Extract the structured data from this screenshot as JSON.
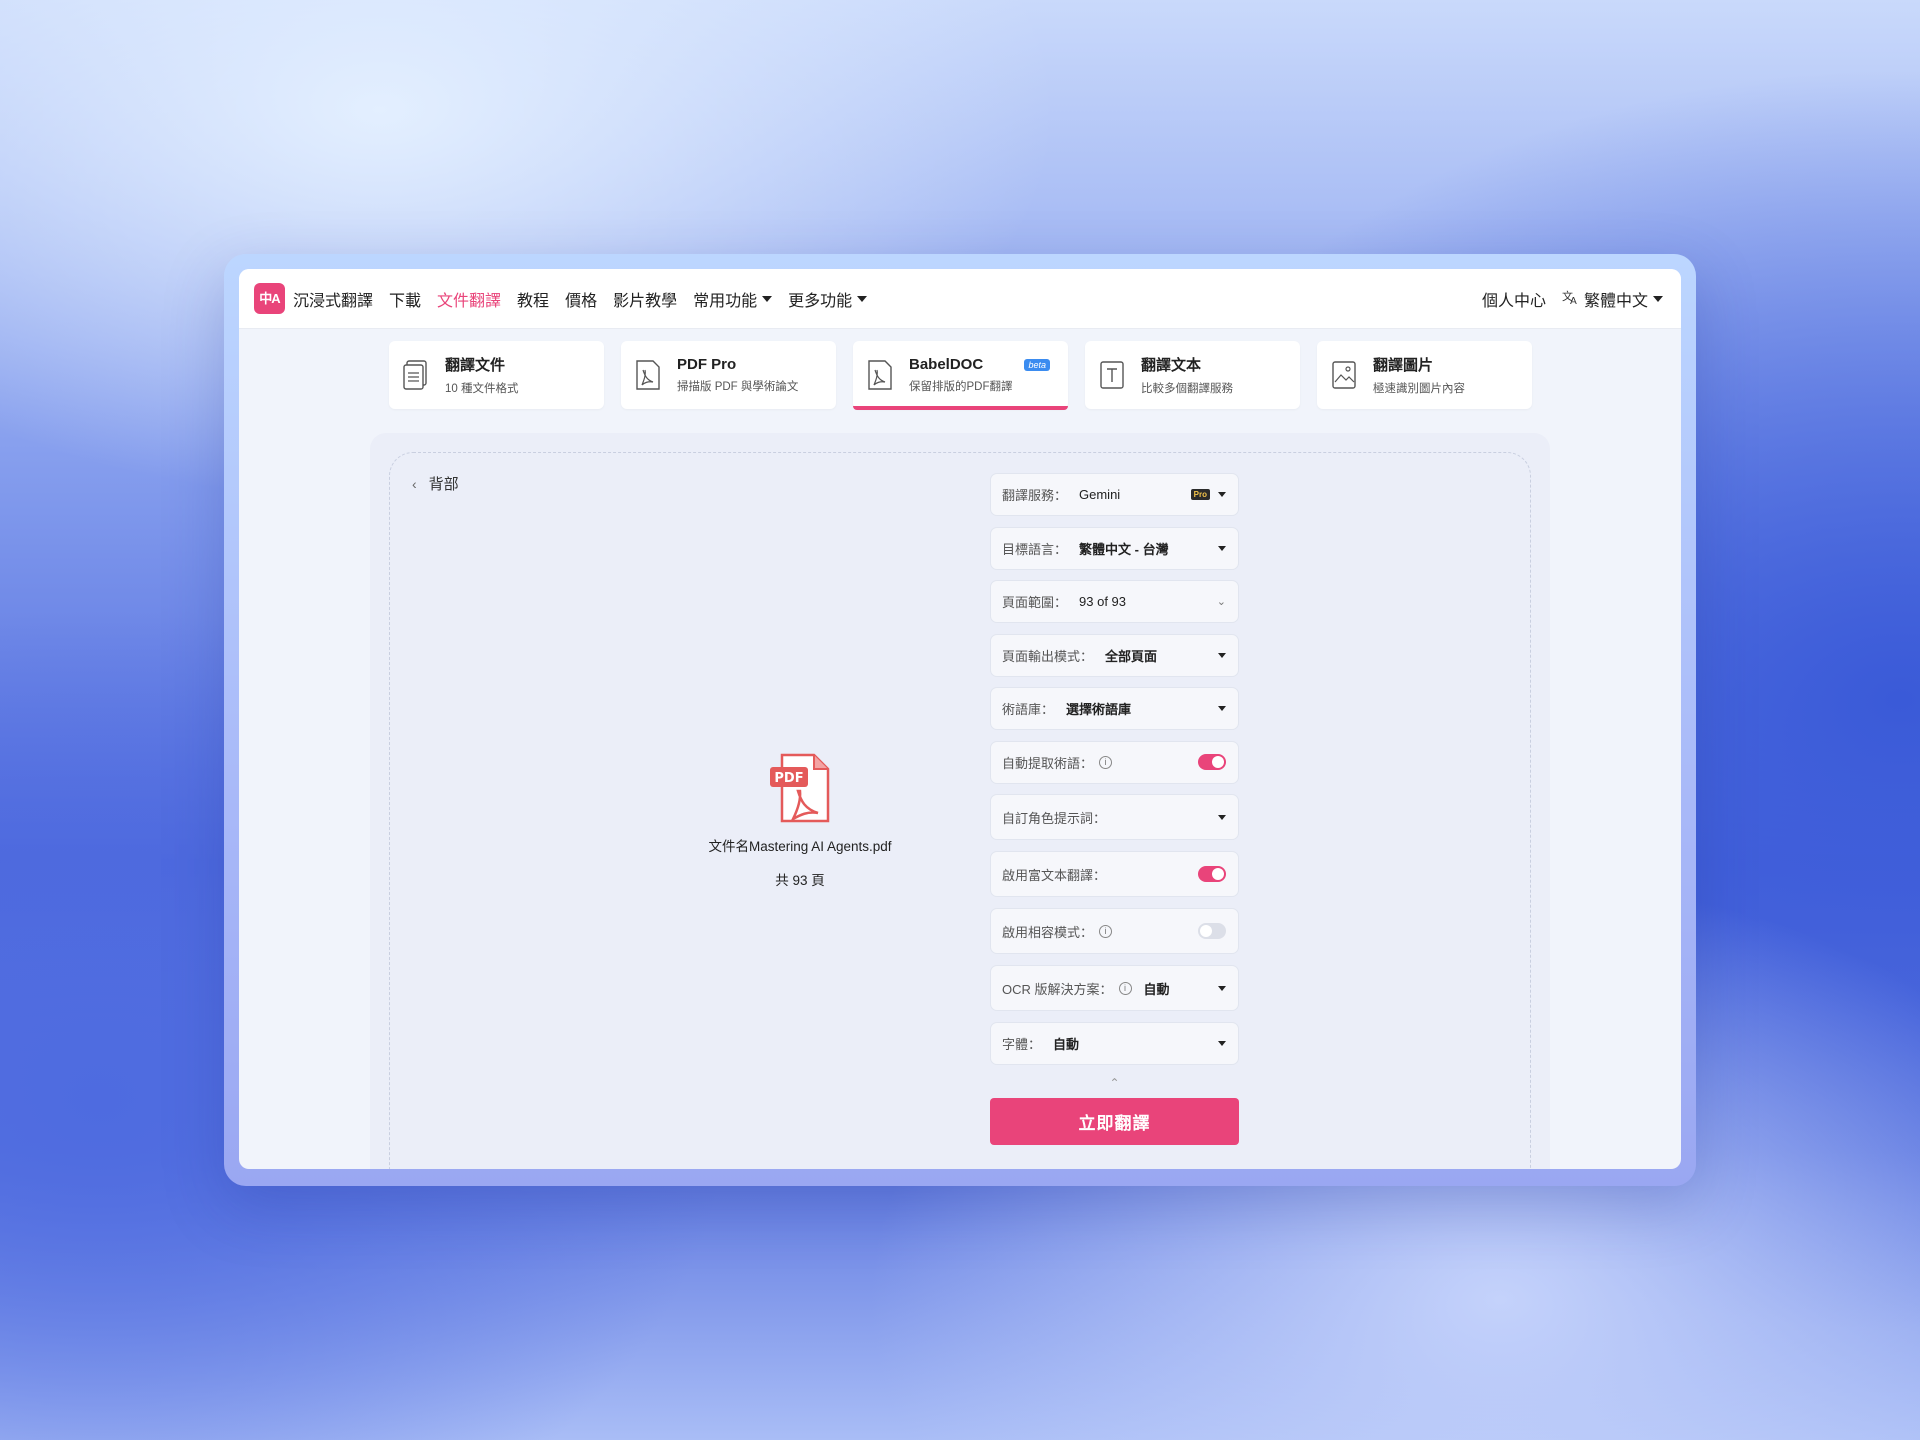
{
  "nav": {
    "logo": "中A",
    "brand": "沉浸式翻譯",
    "items": [
      {
        "label": "下載",
        "active": false,
        "caret": false
      },
      {
        "label": "文件翻譯",
        "active": true,
        "caret": false
      },
      {
        "label": "教程",
        "active": false,
        "caret": false
      },
      {
        "label": "價格",
        "active": false,
        "caret": false
      },
      {
        "label": "影片教學",
        "active": false,
        "caret": false
      },
      {
        "label": "常用功能",
        "active": false,
        "caret": true
      },
      {
        "label": "更多功能",
        "active": false,
        "caret": true
      }
    ],
    "account": "個人中心",
    "language": "繁體中文"
  },
  "tabs": [
    {
      "title": "翻譯文件",
      "sub": "10 種文件格式",
      "icon": "document-icon",
      "active": false
    },
    {
      "title": "PDF Pro",
      "sub": "掃描版 PDF 與學術論文",
      "icon": "pdf-icon",
      "active": false
    },
    {
      "title": "BabelDOC",
      "sub": "保留排版的PDF翻譯",
      "icon": "pdf-icon",
      "active": true,
      "badge": "beta"
    },
    {
      "title": "翻譯文本",
      "sub": "比較多個翻譯服務",
      "icon": "text-icon",
      "active": false
    },
    {
      "title": "翻譯圖片",
      "sub": "極速識別圖片內容",
      "icon": "image-icon",
      "active": false
    }
  ],
  "back_label": "背部",
  "file": {
    "name": "文件名Mastering AI Agents.pdf",
    "pages": "共 93 頁",
    "icon_text": "PDF"
  },
  "settings": {
    "service": {
      "label": "翻譯服務：",
      "value": "Gemini",
      "badge": "Pro"
    },
    "target_lang": {
      "label": "目標語言：",
      "value": "繁體中文 - 台灣"
    },
    "page_range": {
      "label": "頁面範圍：",
      "value": "93 of 93"
    },
    "output_mode": {
      "label": "頁面輸出模式：",
      "value": "全部頁面"
    },
    "glossary": {
      "label": "術語庫：",
      "value": "選擇術語庫"
    },
    "auto_extract": {
      "label": "自動提取術語：",
      "enabled": true
    },
    "role_prompt": {
      "label": "自訂角色提示詞："
    },
    "rich_text": {
      "label": "啟用富文本翻譯：",
      "enabled": true
    },
    "compat_mode": {
      "label": "啟用相容模式：",
      "enabled": false
    },
    "ocr": {
      "label": "OCR 版解決方案：",
      "value": "自動"
    },
    "font": {
      "label": "字體：",
      "value": "自動"
    }
  },
  "submit_label": "立即翻譯",
  "colors": {
    "accent": "#e9447a",
    "beta": "#3b8cf0"
  }
}
